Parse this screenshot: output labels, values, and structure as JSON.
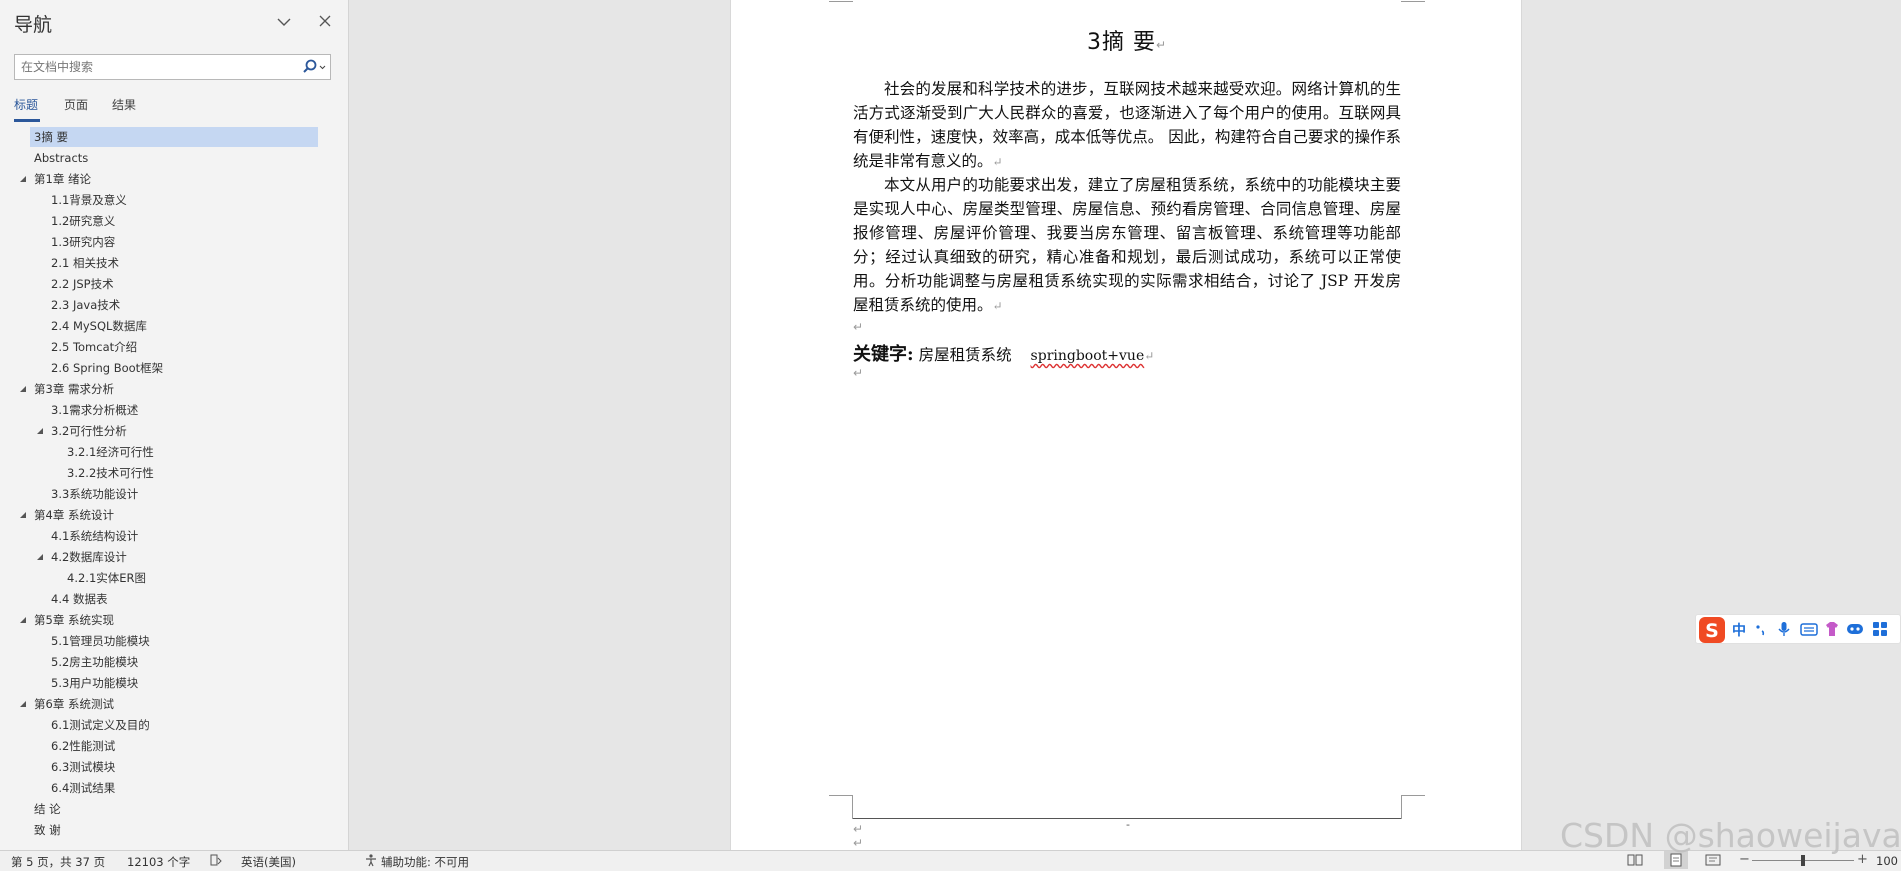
{
  "nav": {
    "title": "导航",
    "search_placeholder": "在文档中搜索",
    "tabs": [
      "标题",
      "页面",
      "结果"
    ],
    "outline": [
      {
        "label": "3摘  要",
        "level": 1,
        "selected": true
      },
      {
        "label": "Abstracts",
        "level": 1
      },
      {
        "label": "第1章 绪论",
        "level": 1,
        "expanded": true
      },
      {
        "label": "1.1背景及意义",
        "level": 2
      },
      {
        "label": "1.2研究意义",
        "level": 2
      },
      {
        "label": "1.3研究内容",
        "level": 2
      },
      {
        "label": "2.1 相关技术",
        "level": 2
      },
      {
        "label": "2.2 JSP技术",
        "level": 2
      },
      {
        "label": "2.3 Java技术",
        "level": 2
      },
      {
        "label": "2.4 MySQL数据库",
        "level": 2
      },
      {
        "label": "2.5 Tomcat介绍",
        "level": 2
      },
      {
        "label": "2.6 Spring Boot框架",
        "level": 2
      },
      {
        "label": "第3章 需求分析",
        "level": 1,
        "expanded": true
      },
      {
        "label": "3.1需求分析概述",
        "level": 2
      },
      {
        "label": "3.2可行性分析",
        "level": 2,
        "expanded": true
      },
      {
        "label": "3.2.1经济可行性",
        "level": 3
      },
      {
        "label": "3.2.2技术可行性",
        "level": 3
      },
      {
        "label": "3.3系统功能设计",
        "level": 2
      },
      {
        "label": "第4章 系统设计",
        "level": 1,
        "expanded": true
      },
      {
        "label": "4.1系统结构设计",
        "level": 2
      },
      {
        "label": "4.2数据库设计",
        "level": 2,
        "expanded": true
      },
      {
        "label": "4.2.1实体ER图",
        "level": 3
      },
      {
        "label": "4.4 数据表",
        "level": 2
      },
      {
        "label": "第5章 系统实现",
        "level": 1,
        "expanded": true
      },
      {
        "label": "5.1管理员功能模块",
        "level": 2
      },
      {
        "label": "5.2房主功能模块",
        "level": 2
      },
      {
        "label": "5.3用户功能模块",
        "level": 2
      },
      {
        "label": "第6章 系统测试",
        "level": 1,
        "expanded": true
      },
      {
        "label": "6.1测试定义及目的",
        "level": 2
      },
      {
        "label": "6.2性能测试",
        "level": 2
      },
      {
        "label": "6.3测试模块",
        "level": 2
      },
      {
        "label": "6.4测试结果",
        "level": 2
      },
      {
        "label": "结  论",
        "level": 1
      },
      {
        "label": "致  谢",
        "level": 1
      }
    ]
  },
  "document": {
    "title": "3摘   要",
    "paragraph1": "社会的发展和科学技术的进步，互联网技术越来越受欢迎。网络计算机的生活方式逐渐受到广大人民群众的喜爱，也逐渐进入了每个用户的使用。互联网具有便利性，速度快，效率高，成本低等优点。 因此，构建符合自己要求的操作系统是非常有意义的。",
    "paragraph2": "本文从用户的功能要求出发，建立了房屋租赁系统，系统中的功能模块主要是实现人中心、房屋类型管理、房屋信息、预约看房管理、合同信息管理、房屋报修管理、房屋评价管理、我要当房东管理、留言板管理、系统管理等功能部分；经过认真细致的研究，精心准备和规划，最后测试成功，系统可以正常使用。分析功能调整与房屋租赁系统实现的实际需求相结合，讨论了 JSP 开发房屋租赁系统的使用。",
    "keywords_label": "关键字:",
    "keywords_cn": "房屋租赁系统",
    "keywords_en": "springboot+vue",
    "footer_dash": "-"
  },
  "status_bar": {
    "page_info": "第 5 页，共 37 页",
    "word_count": "12103 个字",
    "language": "英语(美国)",
    "accessibility": "辅助功能: 不可用",
    "zoom": "100"
  },
  "ime": {
    "mode_label": "中"
  },
  "watermark": "CSDN @shaoweijava"
}
